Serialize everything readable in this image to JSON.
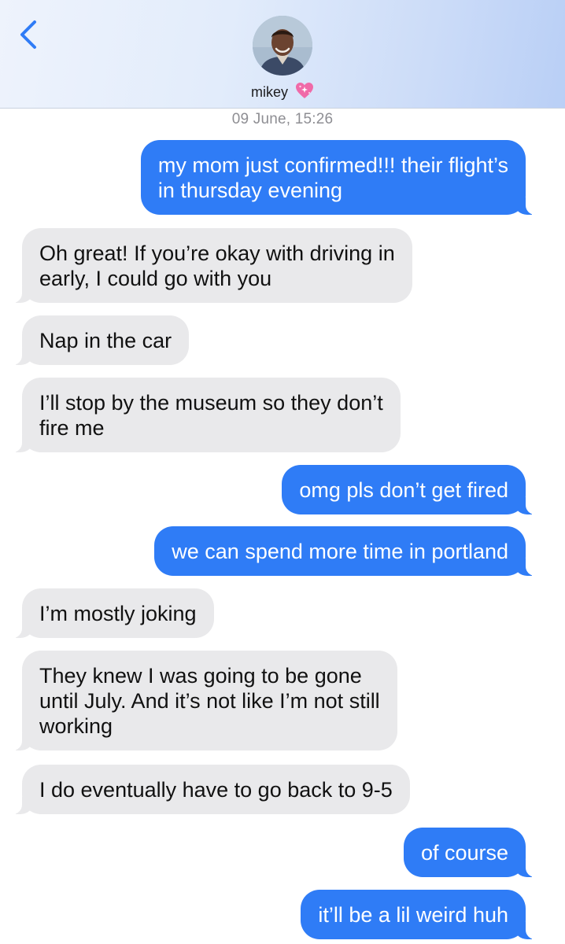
{
  "contact": {
    "name": "mikey",
    "name_emoji": "sparkling-heart-icon"
  },
  "conversation": {
    "timestamp": "09 June, 15:26"
  },
  "colors": {
    "outgoing_bubble": "#2f7cf6",
    "incoming_bubble": "#e9e9eb",
    "accent": "#2f7cf6"
  },
  "messages": [
    {
      "direction": "out",
      "lines": [
        "my mom just confirmed!!! their flight’s",
        "in thursday evening"
      ]
    },
    {
      "direction": "in",
      "lines": [
        "Oh great! If you’re okay with driving in",
        "early, I could go with you"
      ]
    },
    {
      "direction": "in",
      "lines": [
        "Nap in the car"
      ]
    },
    {
      "direction": "in",
      "lines": [
        "I’ll stop by the museum so they don’t",
        "fire me"
      ]
    },
    {
      "direction": "out",
      "lines": [
        "omg pls don’t get fired"
      ]
    },
    {
      "direction": "out",
      "lines": [
        "we can spend more time in portland"
      ]
    },
    {
      "direction": "in",
      "lines": [
        "I’m mostly joking"
      ]
    },
    {
      "direction": "in",
      "lines": [
        "They knew I was going to be gone",
        "until July. And it’s not like I’m not still",
        "working"
      ]
    },
    {
      "direction": "in",
      "lines": [
        "I do eventually have to go back to 9-5"
      ]
    },
    {
      "direction": "out",
      "lines": [
        "of course"
      ]
    },
    {
      "direction": "out",
      "lines": [
        "it’ll be a lil weird huh"
      ]
    }
  ]
}
